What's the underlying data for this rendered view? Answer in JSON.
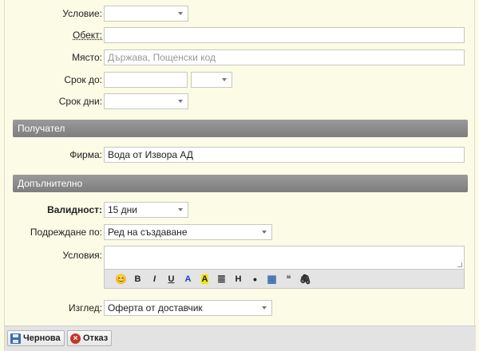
{
  "fields": {
    "condition": {
      "label": "Условие:",
      "value": ""
    },
    "object": {
      "label": "Обект:",
      "value": ""
    },
    "place": {
      "label": "Място:",
      "placeholder": "Държава, Пощенски код"
    },
    "deadline": {
      "label": "Срок до:",
      "value": "",
      "time_value": ""
    },
    "term_days": {
      "label": "Срок дни:",
      "value": ""
    }
  },
  "sections": {
    "recipient": "Получател",
    "additional": "Допълнително"
  },
  "recipient": {
    "company_label": "Фирма:",
    "company_value": "Вода от Извора АД"
  },
  "additional": {
    "validity_label": "Валидност:",
    "validity_value": "15 дни",
    "sort_label": "Подреждане по:",
    "sort_value": "Ред на създаване",
    "conditions_label": "Условия:",
    "view_label": "Изглед:",
    "view_value": "Оферта от доставчик"
  },
  "toolbar": {
    "items": [
      {
        "name": "emoji-icon",
        "glyph": "😊"
      },
      {
        "name": "bold-button",
        "glyph": "B"
      },
      {
        "name": "italic-button",
        "glyph": "I"
      },
      {
        "name": "underline-button",
        "glyph": "U"
      },
      {
        "name": "text-color-button",
        "glyph": "A"
      },
      {
        "name": "highlight-button",
        "glyph": "A"
      },
      {
        "name": "align-icon",
        "glyph": "≣"
      },
      {
        "name": "heading-button",
        "glyph": "H"
      },
      {
        "name": "bullet-list-button",
        "glyph": "•"
      },
      {
        "name": "table-icon",
        "glyph": "▦"
      },
      {
        "name": "quote-icon",
        "glyph": "❝"
      },
      {
        "name": "attach-icon",
        "glyph": "🖇"
      }
    ],
    "text_color": "#1a3fbf",
    "highlight_color": "#f5e600"
  },
  "buttons": {
    "draft": "Чернова",
    "cancel": "Отказ"
  },
  "colors": {
    "background": "#fbfbe6",
    "section_header": "#888888"
  }
}
